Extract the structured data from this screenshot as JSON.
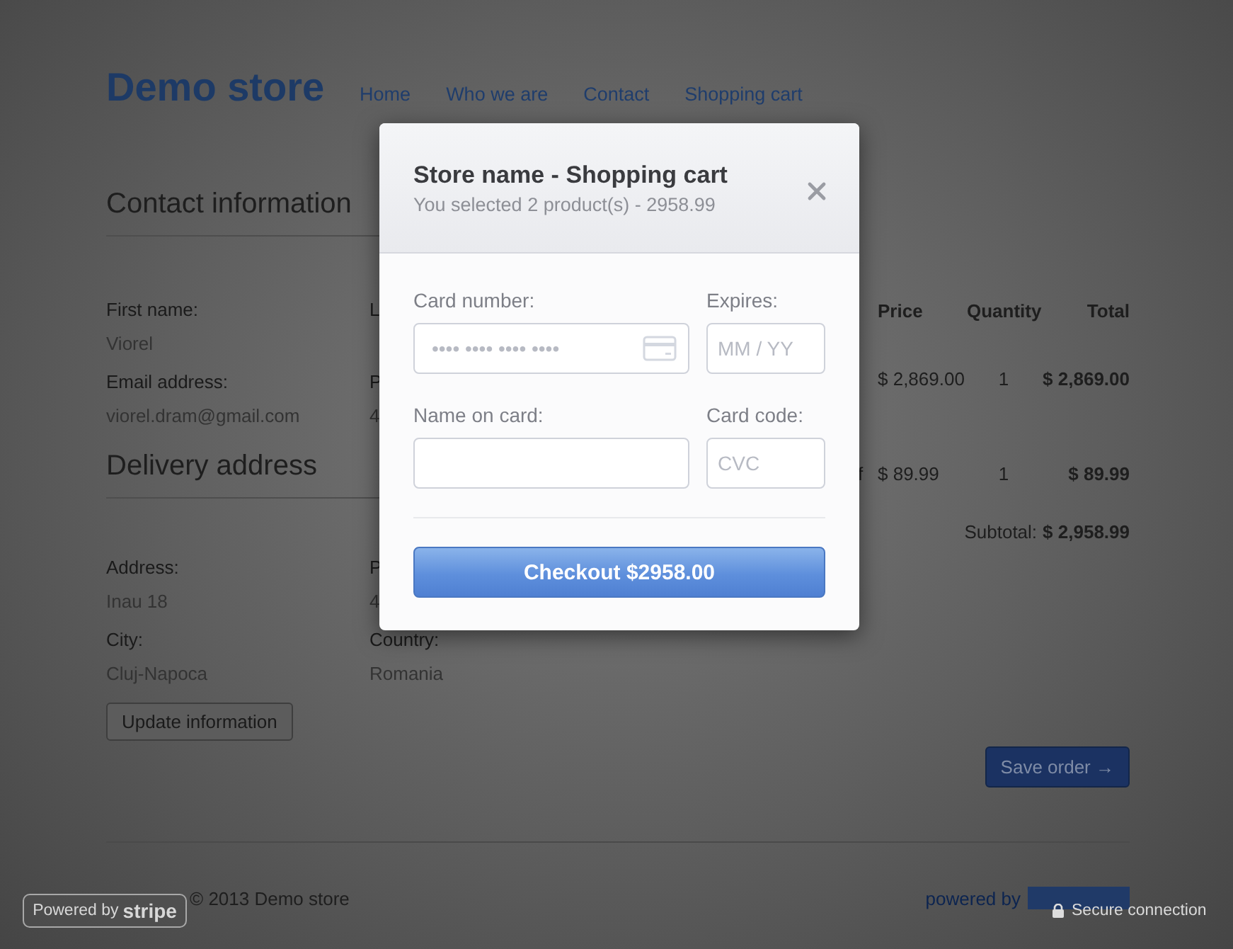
{
  "header": {
    "logo": "Demo store",
    "nav": [
      {
        "label": "Home"
      },
      {
        "label": "Who we are"
      },
      {
        "label": "Contact"
      },
      {
        "label": "Shopping cart"
      }
    ]
  },
  "contact": {
    "title": "Contact information",
    "fields": [
      {
        "label": "First name:",
        "value": "Viorel"
      },
      {
        "label": "L"
      },
      {
        "label": "Email address:",
        "value": "viorel.dram@gmail.com"
      },
      {
        "label": "P",
        "value": "4"
      }
    ]
  },
  "delivery": {
    "title": "Delivery address",
    "fields": [
      {
        "label": "Address:",
        "value": "Inau 18"
      },
      {
        "label": "P",
        "value": "4"
      },
      {
        "label": "City:",
        "value": "Cluj-Napoca"
      },
      {
        "label": "Country:",
        "value": "Romania"
      }
    ],
    "button": "Update information"
  },
  "cart": {
    "columns": [
      "Price",
      "Quantity",
      "Total"
    ],
    "rows": [
      {
        "price": "$ 2,869.00",
        "quantity": "1",
        "total": "$ 2,869.00"
      },
      {
        "name": "f",
        "price": "$ 89.99",
        "quantity": "1",
        "total": "$ 89.99"
      }
    ],
    "subtotal_label": "Subtotal:",
    "subtotal": "$ 2,958.99",
    "save_button": "Save order →"
  },
  "footer": {
    "copyright": "© 2013 Demo store",
    "powered_by": "powered by"
  },
  "modal": {
    "title": "Store name - Shopping cart",
    "subtitle": "You selected 2 product(s) - 2958.99",
    "fields": [
      {
        "label": "Card number:",
        "placeholder": "•••• •••• •••• ••••",
        "kind": "card"
      },
      {
        "label": "Expires:",
        "placeholder": "MM / YY",
        "kind": "short"
      },
      {
        "label": "Name on card:",
        "kind": "text"
      },
      {
        "label": "Card code:",
        "placeholder": "CVC",
        "kind": "short"
      }
    ],
    "button": "Checkout $2958.00"
  },
  "badges": {
    "stripe_prefix": "Powered by",
    "stripe_brand": "stripe",
    "secure": "Secure connection"
  }
}
